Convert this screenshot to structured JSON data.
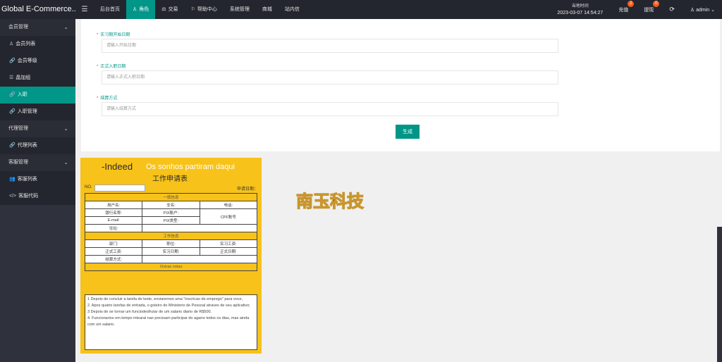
{
  "app": {
    "title": "Global E-Commerce..."
  },
  "topnav": {
    "tabs": [
      {
        "label": "后台首页"
      },
      {
        "label": "角色",
        "icon": "user-icon"
      },
      {
        "label": "交易",
        "icon": "scale-icon"
      },
      {
        "label": "帮助中心",
        "icon": "flag-icon"
      },
      {
        "label": "系统管理"
      },
      {
        "label": "商城"
      },
      {
        "label": "站内信"
      }
    ],
    "active_tab": "角色",
    "clock_label": "当地时间",
    "clock_value": "2023-03-07 14:54:27",
    "recharge": {
      "label": "充值",
      "badge": "2"
    },
    "withdraw": {
      "label": "提现",
      "badge": "0"
    },
    "user": "admin"
  },
  "sidebar": {
    "groups": [
      {
        "label": "会员管理",
        "items": [
          "会员列表",
          "会员等级",
          "晶加组",
          "入职",
          "入职管理"
        ]
      },
      {
        "label": "代理管理",
        "items": [
          "代理列表"
        ]
      },
      {
        "label": "客服管理",
        "items": [
          "客服列表",
          "客服代码"
        ]
      }
    ],
    "active_item": "入职"
  },
  "form": {
    "fields": [
      {
        "label": "实习期开始日期",
        "placeholder": "请输入开始日期",
        "required": true
      },
      {
        "label": "正式入职日期",
        "placeholder": "请输入正式入职日期",
        "required": true
      },
      {
        "label": "结算方式",
        "placeholder": "请输入结算方式",
        "required": true
      }
    ],
    "submit_label": "生成"
  },
  "application": {
    "brand": "-Indeed",
    "slogan": "Os sonhos partiram daqui",
    "title": "工作申请表",
    "no_label": "NO.",
    "date_label": "申请日期：",
    "section_general": "一般信息",
    "general_rows": [
      [
        "用户名:",
        "全名:",
        "电话:"
      ],
      [
        "银行名称:",
        "PIX账户:",
        "CPF账号"
      ],
      [
        "E-mail:",
        "PIX类型:",
        ""
      ],
      [
        "住址:",
        "",
        ""
      ]
    ],
    "section_work": "工作信息",
    "work_rows": [
      [
        "部门:",
        "职位:",
        "实习工资:"
      ],
      [
        "正式工资:",
        "实习日期:",
        "正式日期:"
      ],
      [
        "结算方式:",
        "",
        ""
      ]
    ],
    "section_notes": "Outras notas",
    "notes": [
      "1 Depois de concluir a tarefa de teste, enviaremos uma \"inscricao de emprego\" para voce,",
      "2. Apos quatro tarefas de entrada, o goleiro do Ministerio de Pessoal atraves de seu aplicativo;",
      "3 Depois de se tornar um funciodesfrutar de um salario diario de R$500.",
      "4. Funcionarios em tempo intearal nao precisam participar do agarre todos os dias, mas ainda com um salario."
    ]
  },
  "logo": {
    "text": "南玉科技"
  },
  "colors": {
    "accent": "#009688",
    "topbar": "#23262e",
    "sidebar": "#2f323c",
    "form_yellow": "#f7c21a"
  }
}
